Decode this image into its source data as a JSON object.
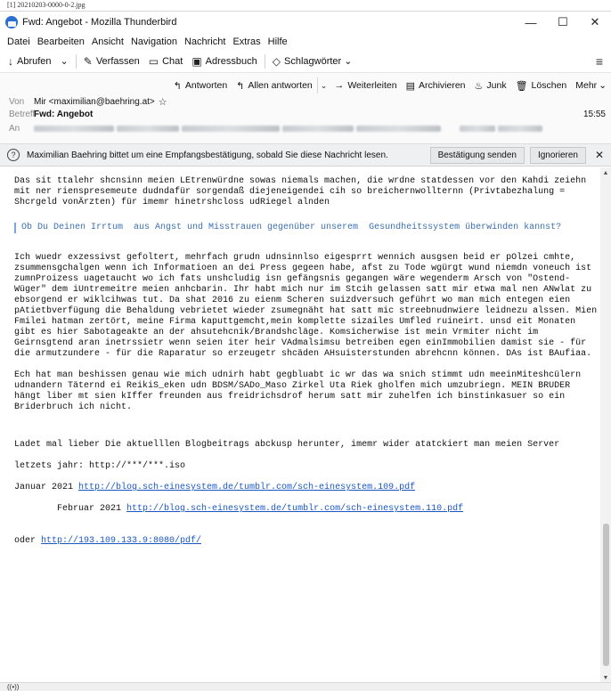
{
  "caption": "[1] 20210203-0000-0-2.jpg",
  "window": {
    "title": "Fwd: Angebot - Mozilla Thunderbird",
    "controls": {
      "minimize": "—",
      "maximize": "☐",
      "close": "✕"
    }
  },
  "menu": [
    "Datei",
    "Bearbeiten",
    "Ansicht",
    "Navigation",
    "Nachricht",
    "Extras",
    "Hilfe"
  ],
  "toolbar": {
    "abrufen": "Abrufen",
    "verfassen": "Verfassen",
    "chat": "Chat",
    "adressbuch": "Adressbuch",
    "schlagwoerter": "Schlagwörter"
  },
  "actions": {
    "antworten": "Antworten",
    "allen_antworten": "Allen antworten",
    "weiterleiten": "Weiterleiten",
    "archivieren": "Archivieren",
    "junk": "Junk",
    "loeschen": "Löschen",
    "mehr": "Mehr"
  },
  "header": {
    "from_label": "Von",
    "from_value": "Mir <maximilian@baehring.at>",
    "subject_label": "Betreff",
    "subject_value": "Fwd: Angebot",
    "time": "15:55",
    "to_label": "An"
  },
  "receipt": {
    "text": "Maximilian Baehring bittet um eine Empfangsbestätigung, sobald Sie diese Nachricht lesen.",
    "send_button": "Bestätigung senden",
    "ignore_button": "Ignorieren"
  },
  "body": {
    "p1": "Das sit ttalehr shcnsinn meien LEtrenwürdne sowas niemals machen, die wrdne statdessen vor den Kahdi zeiehn mit ner rienspresemeute dudndafür sorgendaß diejeneigendei cih so breichernwollternn (Privtabezhalung = Shcrgeld vonÄrzten) für imemr hinetrshcloss udRiegel alnden",
    "quote": "Ob Du Deinen Irrtum  aus Angst und Misstrauen gegenüber unserem  Gesundheitssystem überwinden kannst?",
    "p2": "Ich wuedr exzessivst gefoltert, mehrfach grudn udnsinnlso eigesprrt wennich ausgsen beid er pOlzei cmhte, zsummensgchalgen wenn ich Informatioen an dei Press gegeen habe, afst zu Tode wgürgt wund niemdn voneuch ist zumnProizess uagetaucht wo ich fats unshcludig isn gefängsnis gegangen wäre wegenderm Arsch von \"Ostend-Wüger\" dem iUntremeitre meien anhcbarin. Ihr habt mich nur im Stcih gelassen satt mir etwa mal nen ANwlat zu ebsorgend er wiklcihwas tut. Da shat 2016 zu eienm Scheren suizdversuch geführt wo man mich entegen eien pAtietbverfügung die Behaldung vebrietet wieder zsumegnäht hat satt mic streebnudnwiere leidnezu alssen. Mien Fmilei hatman zertört, meine Firma kaputtgemcht,mein komplette sizailes Umfled ruineirt. unsd eit Monaten gibt es hier Sabotageakte an der ahsutehcnik/Brandshcläge. Komsicherwise ist mein Vrmiter nicht im Geirnsgtend aran inetrssietr wenn seien iter heir VAdmalsimsu betreiben egen einImmobilien damist sie - für die armutzundere - für die Raparatur so erzeugetr shcäden AHsuisterstunden abrehcnn können. DAs ist BAufiaa.",
    "p3": "Ech hat man beshissen genau wie mich udnirh habt gegbluabt ic wr das wa snich stimmt udn meeinMiteshcülern udnandern Täternd ei ReikiS_eken udn BDSM/SADo_Maso Zirkel Uta Riek gholfen mich umzubriegn. MEIN BRUDER hängt liber mt sien kIffer freunden aus freidrichsdrof herum satt mir zuhelfen ich binstinkasuer so ein Briderbruch ich nicht.",
    "p4": "Ladet mal lieber Die aktuelllen Blogbeitrags abckusp herunter, imemr wider atatckiert man meien Server",
    "p5": "letzets jahr: http://***/***.iso",
    "jan_prefix": "Januar 2021 ",
    "jan_link": "http://blog.sch-einesystem.de/tumblr.com/sch-einesystem.109.pdf",
    "feb_prefix": "Februar 2021 ",
    "feb_link": "http://blog.sch-einesystem.de/tumblr.com/sch-einesystem.110.pdf",
    "oder_prefix": "oder ",
    "oder_link": "http://193.109.133.9:8080/pdf/"
  },
  "icons": {
    "app": "thunderbird-icon",
    "abrufen": "↓",
    "verfassen": "✎",
    "chat": "▭",
    "adressbuch": "▣",
    "schlagwoerter": "◇",
    "antworten": "↰",
    "allen_antworten": "↰",
    "weiterleiten": "→",
    "archivieren": "▤",
    "junk": "♨",
    "loeschen": "🗑",
    "star": "☆",
    "receipt": "?",
    "status": "((•))"
  }
}
